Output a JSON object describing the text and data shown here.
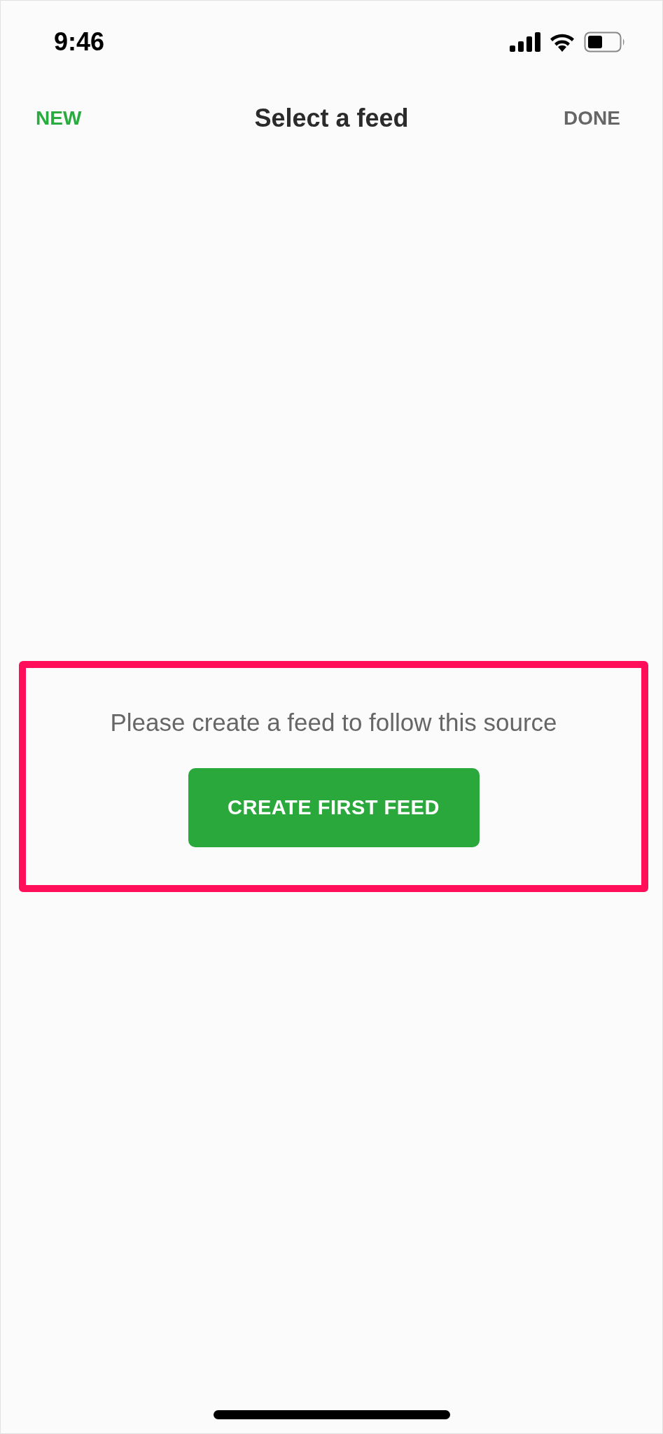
{
  "status_bar": {
    "time": "9:46"
  },
  "nav_bar": {
    "left_action": "NEW",
    "title": "Select a feed",
    "right_action": "DONE"
  },
  "empty_state": {
    "message": "Please create a feed to follow this source",
    "button": "CREATE FIRST FEED"
  }
}
